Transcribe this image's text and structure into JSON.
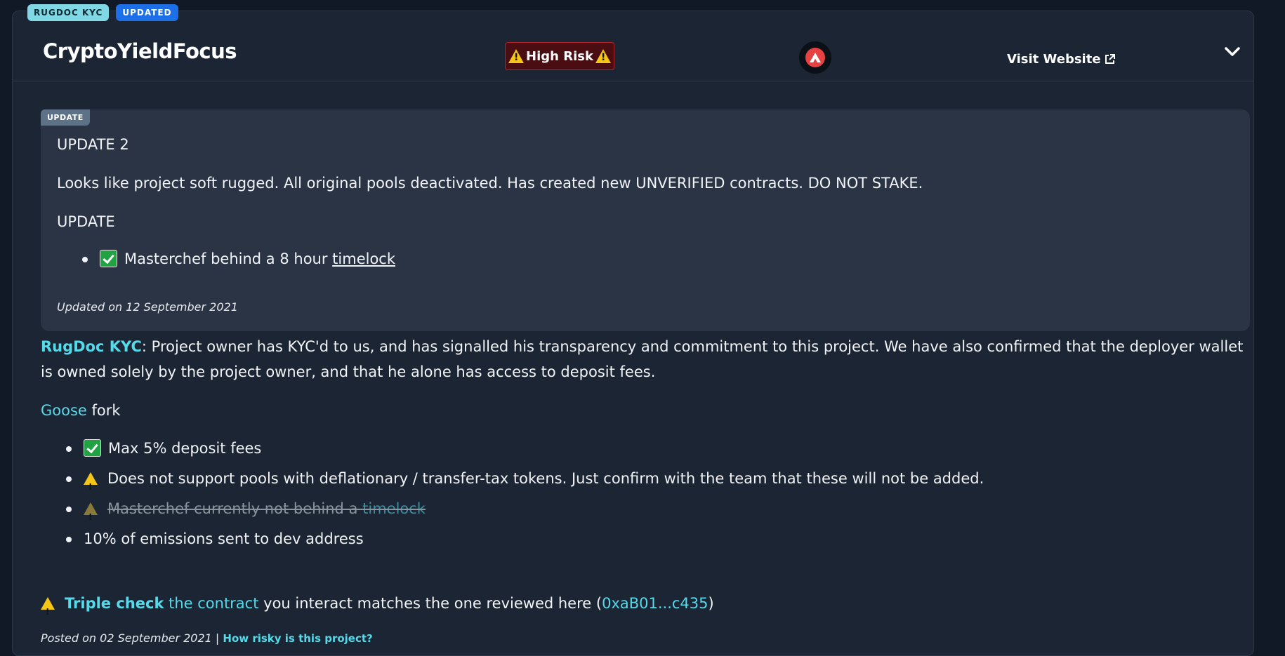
{
  "badges": {
    "kyc": "RUGDOC KYC",
    "updated": "UPDATED"
  },
  "header": {
    "title": "CryptoYieldFocus",
    "risk_label": "High Risk",
    "chain_icon": "avalanche-icon",
    "visit_label": "Visit Website"
  },
  "update_box": {
    "tag": "UPDATE",
    "heading_2": "UPDATE 2",
    "text_2": "Looks like project soft rugged. All original pools deactivated. Has created new UNVERIFIED contracts. DO NOT STAKE.",
    "heading_1": "UPDATE",
    "item_prefix": "Masterchef behind a 8 hour ",
    "item_link": "timelock",
    "updated_on": "Updated on 12 September 2021"
  },
  "kyc": {
    "label": "RugDoc KYC",
    "colon": ":",
    "text": " Project owner has KYC'd to us, and has signalled his transparency and commitment to this project. We have also confirmed that the deployer wallet is owned solely by the project owner, and that he alone has access to deposit fees."
  },
  "fork": {
    "name": "Goose",
    "suffix": " fork"
  },
  "items": [
    {
      "icon": "check",
      "text": "Max 5% deposit fees"
    },
    {
      "icon": "warning",
      "text": "Does not support pools with deflationary / transfer-tax tokens. Just confirm with the team that these will not be added."
    },
    {
      "icon": "warning-struck",
      "text": "Masterchef currently not behind a ",
      "link": "timelock"
    },
    {
      "icon": "none",
      "text": "10% of emissions sent to dev address"
    }
  ],
  "triple_check": {
    "bold": "Triple check",
    "link": " the contract",
    "middle": " you interact matches the one reviewed here (",
    "address": "0xaB01...c435",
    "close": ")"
  },
  "footer": {
    "posted": "Posted on 02 September 2021",
    "separator": " | ",
    "link": "How risky is this project?"
  },
  "colors": {
    "background": "#111826",
    "card": "#1b2534",
    "accent_cyan": "#56d9e8",
    "risk_red": "#b3252b",
    "update_blue": "#1d6fe8"
  }
}
